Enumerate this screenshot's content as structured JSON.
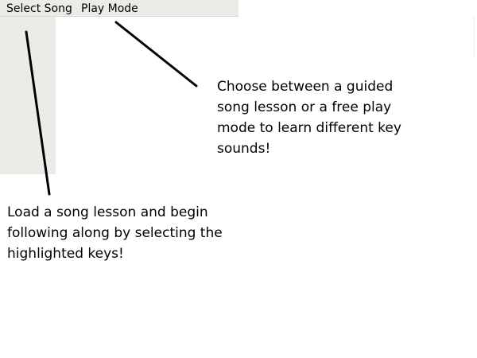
{
  "menubar": {
    "select_song": "Select Song",
    "play_mode": "Play Mode"
  },
  "annotations": {
    "play_mode_note": "Choose between a guided song lesson or a free play mode to learn different key sounds!",
    "select_song_note": "Load a song lesson and begin following along by selecting the highlighted keys!"
  },
  "colors": {
    "panel_background": "#edebe7",
    "page_background": "#ffffff",
    "text": "#000000",
    "arrow": "#000000"
  }
}
